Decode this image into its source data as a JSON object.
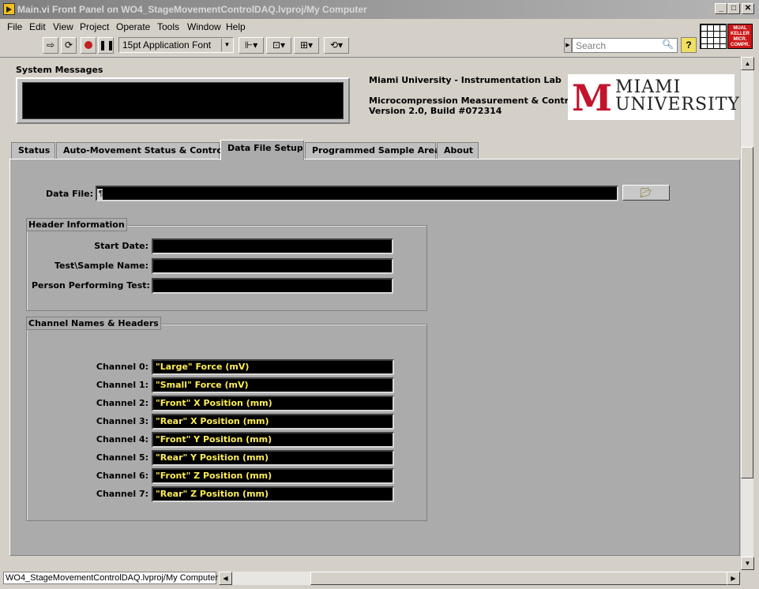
{
  "window": {
    "title": "Main.vi Front Panel on WO4_StageMovementControlDAQ.lvproj/My Computer",
    "minimize": "_",
    "maximize": "□",
    "close": "✕"
  },
  "menu": [
    "File",
    "Edit",
    "View",
    "Project",
    "Operate",
    "Tools",
    "Window",
    "Help"
  ],
  "toolbar": {
    "font": "15pt Application Font",
    "search_placeholder": "Search",
    "help": "?"
  },
  "vi_badge": "MUAL KELLER MICR. COMPR.",
  "system_messages": {
    "label": "System Messages",
    "value": ""
  },
  "info": {
    "lab": "Miami University - Instrumentation Lab",
    "app": "Microcompression Measurement & Control",
    "version": "Version 2.0, Build #072314"
  },
  "logo": {
    "mark": "M",
    "line1": "MIAMI",
    "line2": "UNIVERSITY"
  },
  "tabs": [
    {
      "label": "Status",
      "active": false
    },
    {
      "label": "Auto-Movement Status & Control",
      "active": false
    },
    {
      "label": "Data File Setup",
      "active": true
    },
    {
      "label": "Programmed Sample Area",
      "active": false
    },
    {
      "label": "About",
      "active": false
    }
  ],
  "data_file": {
    "label": "Data File:",
    "path_icon": "¶",
    "value": ""
  },
  "header_info": {
    "title": "Header Information",
    "fields": [
      {
        "label": "Start Date:",
        "value": ""
      },
      {
        "label": "Test\\Sample Name:",
        "value": ""
      },
      {
        "label": "Person Performing Test:",
        "value": ""
      }
    ]
  },
  "channels": {
    "title": "Channel Names & Headers",
    "items": [
      {
        "label": "Channel 0:",
        "value": "\"Large\" Force (mV)"
      },
      {
        "label": "Channel 1:",
        "value": "\"Small\" Force (mV)"
      },
      {
        "label": "Channel 2:",
        "value": "\"Front\" X Position (mm)"
      },
      {
        "label": "Channel 3:",
        "value": "\"Rear\" X Position (mm)"
      },
      {
        "label": "Channel 4:",
        "value": "\"Front\" Y Position (mm)"
      },
      {
        "label": "Channel 5:",
        "value": "\"Rear\" Y Position (mm)"
      },
      {
        "label": "Channel 6:",
        "value": "\"Front\" Z Position (mm)"
      },
      {
        "label": "Channel 7:",
        "value": "\"Rear\" Z Position (mm)"
      }
    ]
  },
  "statusbar": {
    "text": "WO4_StageMovementControlDAQ.lvproj/My Computer"
  }
}
